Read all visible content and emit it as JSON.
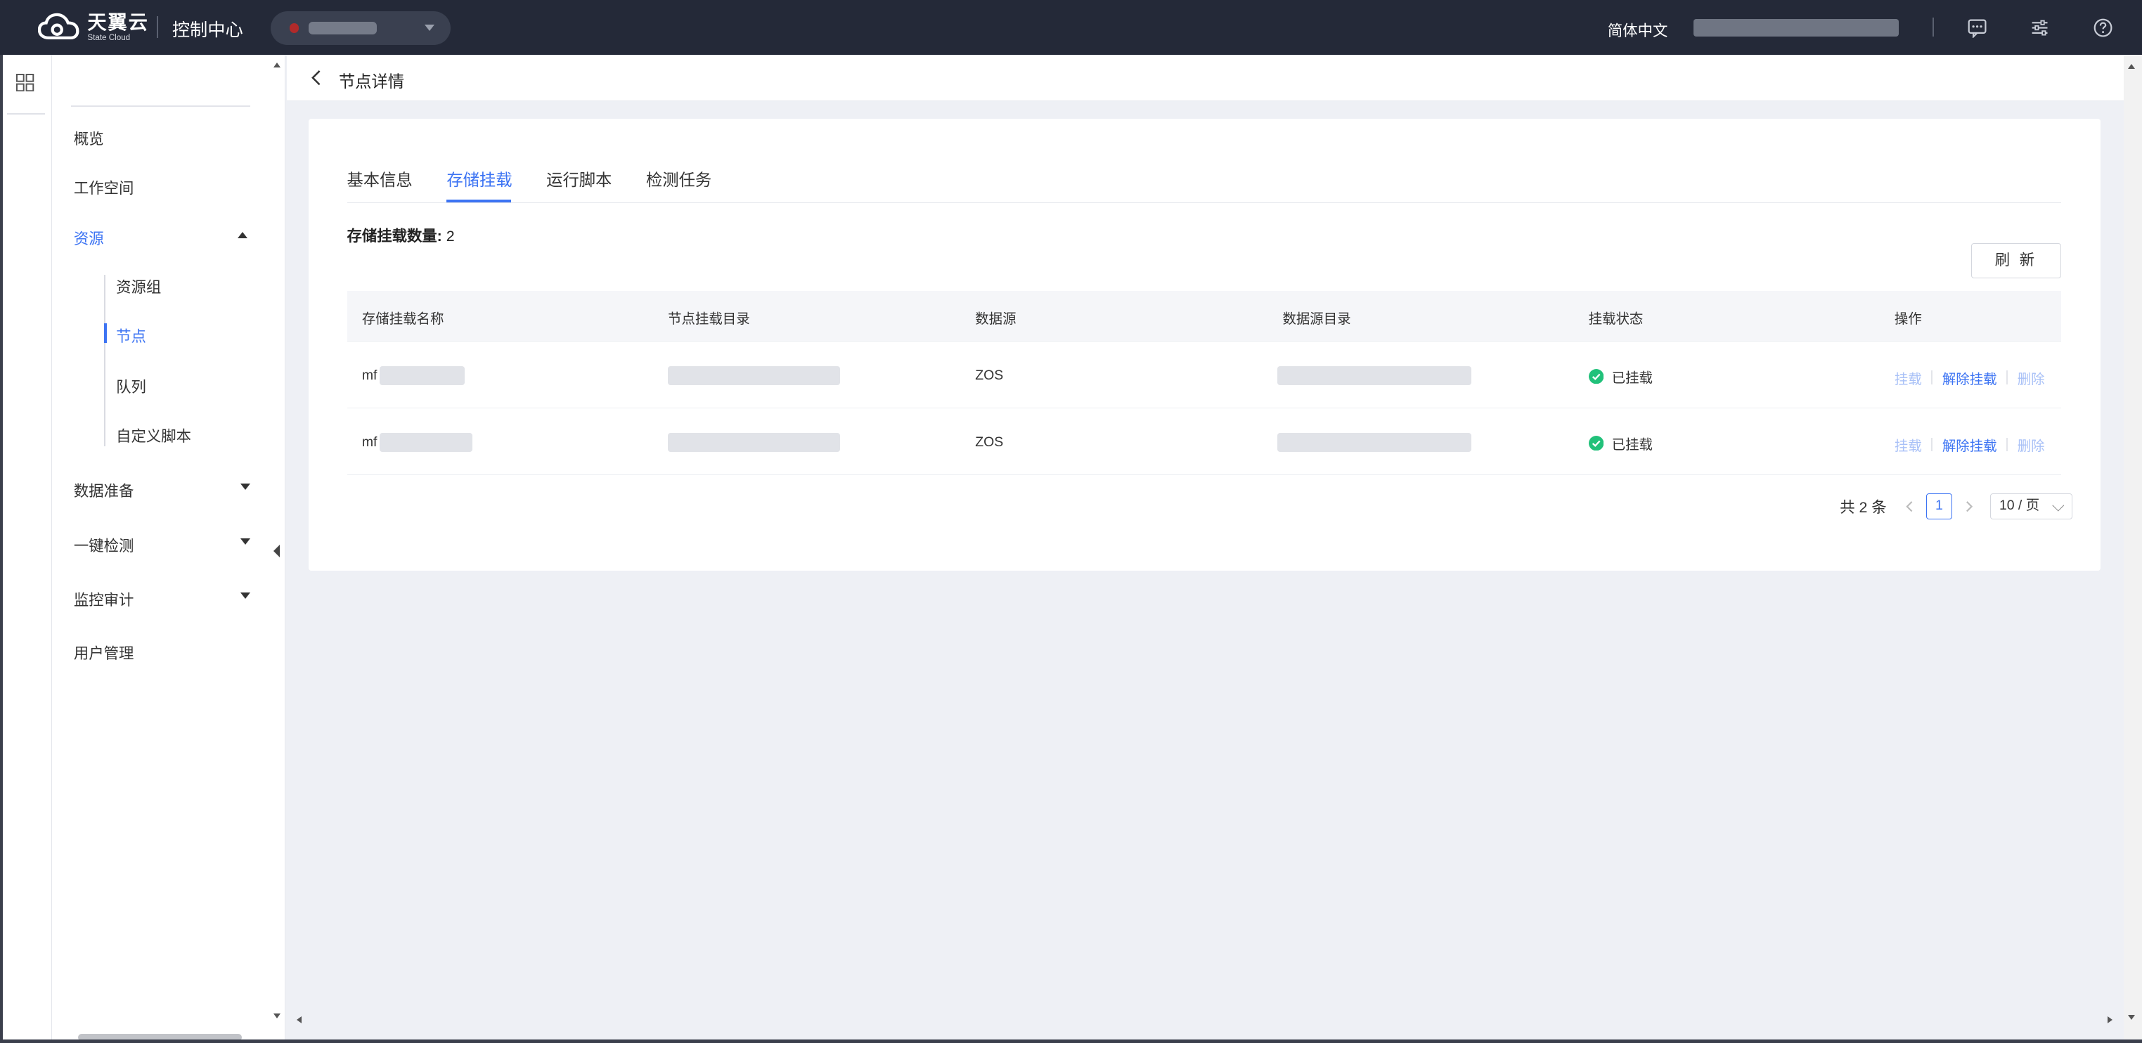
{
  "topbar": {
    "logo_cn": "天翼云",
    "logo_en": "State Cloud",
    "app_title": "控制中心",
    "language": "简体中文"
  },
  "sidebar": {
    "items": [
      {
        "label": "概览"
      },
      {
        "label": "工作空间"
      },
      {
        "label": "资源",
        "expanded": true
      },
      {
        "label": "数据准备"
      },
      {
        "label": "一键检测"
      },
      {
        "label": "监控审计"
      },
      {
        "label": "用户管理"
      }
    ],
    "resource_children": [
      {
        "label": "资源组"
      },
      {
        "label": "节点",
        "active": true
      },
      {
        "label": "队列"
      },
      {
        "label": "自定义脚本"
      }
    ]
  },
  "page": {
    "title": "节点详情"
  },
  "tabs": [
    {
      "label": "基本信息"
    },
    {
      "label": "存储挂载",
      "active": true
    },
    {
      "label": "运行脚本"
    },
    {
      "label": "检测任务"
    }
  ],
  "storage": {
    "count_label": "存储挂载数量:",
    "count_value": "2",
    "refresh_label": "刷 新"
  },
  "table": {
    "columns": [
      "存储挂载名称",
      "节点挂载目录",
      "数据源",
      "数据源目录",
      "挂载状态",
      "操作"
    ],
    "rows": [
      {
        "name_prefix": "mf",
        "datasource": "ZOS",
        "status": "已挂载"
      },
      {
        "name_prefix": "mf",
        "datasource": "ZOS",
        "status": "已挂载"
      }
    ],
    "actions": {
      "mount": "挂载",
      "unmount": "解除挂载",
      "delete": "删除"
    }
  },
  "pagination": {
    "total_text": "共 2 条",
    "current_page": "1",
    "page_size": "10 / 页"
  },
  "colors": {
    "topbar": "#242938",
    "accent": "#3d74f3",
    "success": "#21c17a",
    "page_bg": "#eef0f5"
  }
}
